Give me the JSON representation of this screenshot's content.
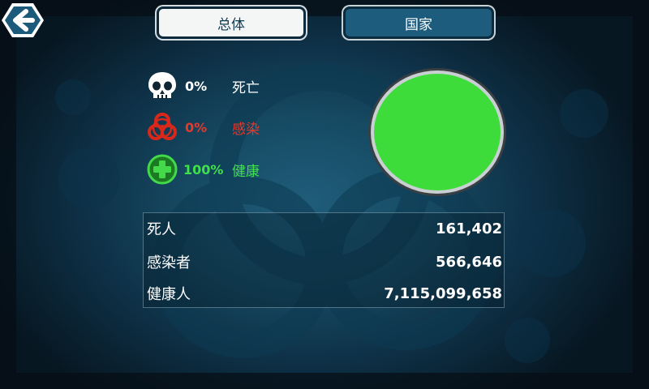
{
  "tabs": {
    "overall": "总体",
    "country": "国家"
  },
  "stats": [
    {
      "icon": "skull-icon",
      "percent": "0%",
      "label": "死亡",
      "color": "#ffffff"
    },
    {
      "icon": "biohazard-icon",
      "percent": "0%",
      "label": "感染",
      "color": "#e33a2c"
    },
    {
      "icon": "plus-cross-icon",
      "percent": "100%",
      "label": "健康",
      "color": "#3fe04a"
    }
  ],
  "pie_chart": {
    "type": "pie",
    "slices": [
      {
        "name": "健康",
        "value": 100,
        "color": "#3ddc3a"
      },
      {
        "name": "感染",
        "value": 0,
        "color": "#e33a2c"
      },
      {
        "name": "死亡",
        "value": 0,
        "color": "#ffffff"
      }
    ]
  },
  "table": {
    "rows": [
      {
        "label": "死人",
        "value": "161,402"
      },
      {
        "label": "感染者",
        "value": "566,646"
      },
      {
        "label": "健康人",
        "value": "7,115,099,658"
      }
    ]
  },
  "colors": {
    "accent": "#1d5c7d",
    "background": "#164a63"
  }
}
